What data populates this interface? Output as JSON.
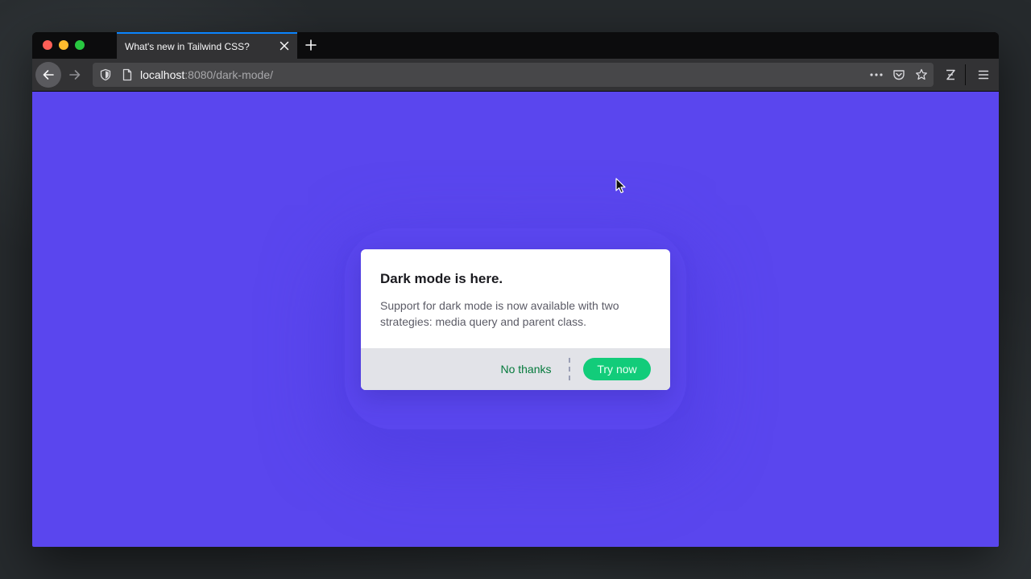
{
  "browser": {
    "tab": {
      "title": "What's new in Tailwind CSS?"
    },
    "url": {
      "host": "localhost",
      "rest": ":8080/dark-mode/"
    }
  },
  "icons": {
    "traffic": [
      "close-window",
      "minimize-window",
      "zoom-window"
    ],
    "nav": [
      "back-arrow",
      "forward-arrow"
    ],
    "url_bar": [
      "shield",
      "page",
      "more-dots",
      "pocket",
      "star"
    ],
    "toolbar": [
      "zotero-z",
      "hamburger-menu"
    ]
  },
  "colors": {
    "page_background": "#5a46ee",
    "modal_footer": "#e2e3e8",
    "secondary_button_text": "#057a3c",
    "primary_button": "#12cc7a",
    "tab_accent": "#0a84ff"
  },
  "modal": {
    "title": "Dark mode is here.",
    "body": "Support for dark mode is now available with two strategies: media query and parent class.",
    "secondary_button": "No thanks",
    "primary_button": "Try now"
  }
}
